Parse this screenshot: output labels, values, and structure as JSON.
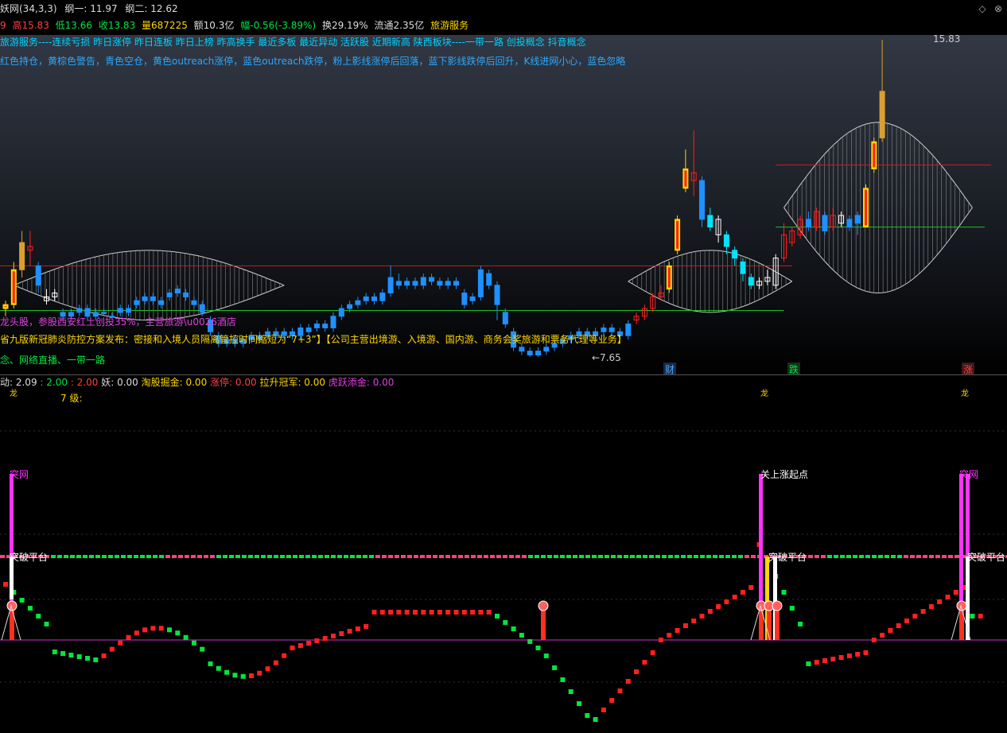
{
  "title": {
    "indicator": "妖网(34,3,3)",
    "gang1_label": "纲一: 11.97",
    "gang2_label": "纲二: 12.62"
  },
  "quote": {
    "high": "高15.83",
    "low": "低13.66",
    "close": "收13.83",
    "volume": "量687225",
    "amount": "额10.3亿",
    "change": "幅-0.56(-3.89%)",
    "turnover": "换29.19%",
    "float": "流通2.35亿",
    "sector": "旅游服务",
    "prefix": "9"
  },
  "overlay_texts": {
    "concepts": "旅游服务----连续亏损 昨日涨停 昨日连板 昨日上榜 昨高换手 最近多板 最近异动 活跃股 近期新高 陕西板块----一带一路 创投概念 抖音概念",
    "legend": "红色持仓，黄棕色警告，青色空仓，黄色outreach涨停，蓝色outreach跌停，粉上影线涨停后回落，蓝下影线跌停后回升，K线进网小心，蓝色忽略",
    "news1": "龙头股，参股西安红土创投35%，主营旅游\\u0026酒店",
    "news2": "省九版新冠肺炎防控方案发布：密接和入境人员隔离管控时间缩短为“7+3”】【公司主营出境游、入境游、国内游、商务会奖旅游和票务代理等业务】",
    "news3": "念、网络直播、一带一路",
    "max_price": "15.83",
    "min_price": "←7.65",
    "tag_cai": "财",
    "tag_die": "跌",
    "tag_zhang": "涨"
  },
  "sub_indicator": {
    "dong": "动: 2.09",
    "v2": ": 2.00",
    "v3": ": 2.00",
    "yao": "妖: 0.00",
    "taogu": "淘股掘金: 0.00",
    "zhangting": "涨停: 0.00",
    "lasheng": "拉升冠军: 0.00",
    "huyue": "虎跃添金: 0.00",
    "level": "7    级:",
    "long_mark": "龙"
  },
  "sub_labels": {
    "tuwang": "突网",
    "tupo": "突破平台",
    "qidian": "关上涨起点",
    "tupo2": "突破平台"
  },
  "colors": {
    "up_red": "#ff2020",
    "down_blue": "#1e90ff",
    "cyan": "#00e5ff",
    "yellow": "#ffd700",
    "magenta": "#ff33ff",
    "green": "#00e640",
    "pink": "#ff4080"
  },
  "chart_data": {
    "type": "candlestick",
    "price_labels": {
      "max": 15.83,
      "min": 7.65
    },
    "candles": [
      {
        "o": 8.9,
        "c": 9.0,
        "h": 9.1,
        "l": 8.7,
        "k": "yellow"
      },
      {
        "o": 9.0,
        "c": 9.9,
        "h": 10.1,
        "l": 8.9,
        "k": "yellow"
      },
      {
        "o": 9.9,
        "c": 10.6,
        "h": 10.9,
        "l": 9.7,
        "k": "brown"
      },
      {
        "o": 10.5,
        "c": 10.4,
        "h": 10.9,
        "l": 10.0,
        "k": "red"
      },
      {
        "o": 10.0,
        "c": 9.5,
        "h": 10.1,
        "l": 9.3,
        "k": "blue"
      },
      {
        "o": 9.2,
        "c": 9.1,
        "h": 9.4,
        "l": 9.0,
        "k": "white"
      },
      {
        "o": 9.2,
        "c": 9.3,
        "h": 9.4,
        "l": 9.1,
        "k": "white"
      },
      {
        "o": 8.8,
        "c": 8.7,
        "h": 8.9,
        "l": 8.6,
        "k": "blue"
      },
      {
        "o": 8.7,
        "c": 8.8,
        "h": 8.9,
        "l": 8.6,
        "k": "blue"
      },
      {
        "o": 8.9,
        "c": 8.8,
        "h": 9.0,
        "l": 8.7,
        "k": "blue"
      },
      {
        "o": 8.7,
        "c": 8.9,
        "h": 9.0,
        "l": 8.6,
        "k": "blue"
      },
      {
        "o": 8.8,
        "c": 8.7,
        "h": 8.9,
        "l": 8.6,
        "k": "blue"
      },
      {
        "o": 8.8,
        "c": 8.8,
        "h": 8.9,
        "l": 8.7,
        "k": "blue"
      },
      {
        "o": 8.7,
        "c": 8.7,
        "h": 8.8,
        "l": 8.6,
        "k": "blue"
      },
      {
        "o": 8.8,
        "c": 8.9,
        "h": 9.0,
        "l": 8.7,
        "k": "blue"
      },
      {
        "o": 8.9,
        "c": 8.8,
        "h": 9.0,
        "l": 8.7,
        "k": "blue"
      },
      {
        "o": 9.0,
        "c": 9.1,
        "h": 9.2,
        "l": 8.9,
        "k": "blue"
      },
      {
        "o": 9.1,
        "c": 9.2,
        "h": 9.3,
        "l": 9.0,
        "k": "blue"
      },
      {
        "o": 9.2,
        "c": 9.1,
        "h": 9.3,
        "l": 9.0,
        "k": "blue"
      },
      {
        "o": 9.1,
        "c": 9.0,
        "h": 9.2,
        "l": 8.9,
        "k": "blue"
      },
      {
        "o": 9.2,
        "c": 9.3,
        "h": 9.4,
        "l": 9.1,
        "k": "blue"
      },
      {
        "o": 9.3,
        "c": 9.4,
        "h": 9.5,
        "l": 9.2,
        "k": "blue"
      },
      {
        "o": 9.3,
        "c": 9.2,
        "h": 9.4,
        "l": 9.1,
        "k": "blue"
      },
      {
        "o": 9.1,
        "c": 9.0,
        "h": 9.2,
        "l": 8.9,
        "k": "blue"
      },
      {
        "o": 9.0,
        "c": 8.8,
        "h": 9.1,
        "l": 8.7,
        "k": "blue"
      },
      {
        "o": 8.6,
        "c": 8.3,
        "h": 8.7,
        "l": 8.2,
        "k": "blue"
      },
      {
        "o": 8.2,
        "c": 8.0,
        "h": 8.3,
        "l": 7.9,
        "k": "blue"
      },
      {
        "o": 8.1,
        "c": 8.0,
        "h": 8.2,
        "l": 7.9,
        "k": "blue"
      },
      {
        "o": 8.0,
        "c": 8.1,
        "h": 8.2,
        "l": 7.9,
        "k": "blue"
      },
      {
        "o": 8.1,
        "c": 8.0,
        "h": 8.2,
        "l": 7.9,
        "k": "blue"
      },
      {
        "o": 8.1,
        "c": 8.2,
        "h": 8.3,
        "l": 8.0,
        "k": "blue"
      },
      {
        "o": 8.2,
        "c": 8.1,
        "h": 8.3,
        "l": 8.0,
        "k": "blue"
      },
      {
        "o": 8.2,
        "c": 8.3,
        "h": 8.4,
        "l": 8.1,
        "k": "blue"
      },
      {
        "o": 8.3,
        "c": 8.2,
        "h": 8.4,
        "l": 8.1,
        "k": "blue"
      },
      {
        "o": 8.2,
        "c": 8.3,
        "h": 8.4,
        "l": 8.1,
        "k": "blue"
      },
      {
        "o": 8.3,
        "c": 8.2,
        "h": 8.4,
        "l": 8.1,
        "k": "blue"
      },
      {
        "o": 8.2,
        "c": 8.4,
        "h": 8.5,
        "l": 8.1,
        "k": "blue"
      },
      {
        "o": 8.4,
        "c": 8.3,
        "h": 8.5,
        "l": 8.2,
        "k": "blue"
      },
      {
        "o": 8.4,
        "c": 8.5,
        "h": 8.6,
        "l": 8.3,
        "k": "blue"
      },
      {
        "o": 8.5,
        "c": 8.4,
        "h": 8.6,
        "l": 8.3,
        "k": "blue"
      },
      {
        "o": 8.4,
        "c": 8.7,
        "h": 8.8,
        "l": 8.3,
        "k": "blue"
      },
      {
        "o": 8.7,
        "c": 8.9,
        "h": 9.0,
        "l": 8.6,
        "k": "blue"
      },
      {
        "o": 8.9,
        "c": 9.0,
        "h": 9.1,
        "l": 8.8,
        "k": "blue"
      },
      {
        "o": 9.0,
        "c": 9.1,
        "h": 9.2,
        "l": 8.9,
        "k": "blue"
      },
      {
        "o": 9.1,
        "c": 9.2,
        "h": 9.3,
        "l": 9.0,
        "k": "blue"
      },
      {
        "o": 9.2,
        "c": 9.1,
        "h": 9.3,
        "l": 9.0,
        "k": "blue"
      },
      {
        "o": 9.1,
        "c": 9.3,
        "h": 9.4,
        "l": 9.0,
        "k": "blue"
      },
      {
        "o": 9.3,
        "c": 9.7,
        "h": 10.0,
        "l": 9.2,
        "k": "blue"
      },
      {
        "o": 9.6,
        "c": 9.5,
        "h": 9.8,
        "l": 9.4,
        "k": "blue"
      },
      {
        "o": 9.5,
        "c": 9.6,
        "h": 9.7,
        "l": 9.4,
        "k": "blue"
      },
      {
        "o": 9.6,
        "c": 9.5,
        "h": 9.7,
        "l": 9.4,
        "k": "blue"
      },
      {
        "o": 9.5,
        "c": 9.7,
        "h": 9.8,
        "l": 9.4,
        "k": "blue"
      },
      {
        "o": 9.7,
        "c": 9.6,
        "h": 9.8,
        "l": 9.5,
        "k": "blue"
      },
      {
        "o": 9.6,
        "c": 9.5,
        "h": 9.7,
        "l": 9.4,
        "k": "blue"
      },
      {
        "o": 9.5,
        "c": 9.6,
        "h": 9.7,
        "l": 9.4,
        "k": "blue"
      },
      {
        "o": 9.6,
        "c": 9.5,
        "h": 9.7,
        "l": 9.4,
        "k": "blue"
      },
      {
        "o": 9.3,
        "c": 9.0,
        "h": 9.4,
        "l": 8.9,
        "k": "blue"
      },
      {
        "o": 9.1,
        "c": 9.2,
        "h": 9.3,
        "l": 9.0,
        "k": "blue"
      },
      {
        "o": 9.2,
        "c": 9.9,
        "h": 10.0,
        "l": 9.1,
        "k": "blue"
      },
      {
        "o": 9.8,
        "c": 9.5,
        "h": 9.9,
        "l": 9.4,
        "k": "blue"
      },
      {
        "o": 9.5,
        "c": 9.0,
        "h": 9.6,
        "l": 8.6,
        "k": "blue"
      },
      {
        "o": 8.8,
        "c": 8.5,
        "h": 8.9,
        "l": 8.4,
        "k": "blue"
      },
      {
        "o": 8.3,
        "c": 7.9,
        "h": 8.4,
        "l": 7.8,
        "k": "blue"
      },
      {
        "o": 7.9,
        "c": 7.8,
        "h": 8.0,
        "l": 7.7,
        "k": "blue"
      },
      {
        "o": 7.8,
        "c": 7.7,
        "h": 7.9,
        "l": 7.65,
        "k": "blue"
      },
      {
        "o": 7.7,
        "c": 7.8,
        "h": 7.9,
        "l": 7.65,
        "k": "blue"
      },
      {
        "o": 7.8,
        "c": 7.9,
        "h": 8.0,
        "l": 7.7,
        "k": "blue"
      },
      {
        "o": 7.9,
        "c": 8.0,
        "h": 8.1,
        "l": 7.8,
        "k": "blue"
      },
      {
        "o": 8.0,
        "c": 8.1,
        "h": 8.2,
        "l": 7.9,
        "k": "blue"
      },
      {
        "o": 8.1,
        "c": 8.2,
        "h": 8.3,
        "l": 8.0,
        "k": "blue"
      },
      {
        "o": 8.2,
        "c": 8.3,
        "h": 8.4,
        "l": 8.1,
        "k": "blue"
      },
      {
        "o": 8.3,
        "c": 8.2,
        "h": 8.4,
        "l": 8.1,
        "k": "blue"
      },
      {
        "o": 8.2,
        "c": 8.3,
        "h": 8.4,
        "l": 8.1,
        "k": "blue"
      },
      {
        "o": 8.3,
        "c": 8.4,
        "h": 8.5,
        "l": 8.2,
        "k": "blue"
      },
      {
        "o": 8.4,
        "c": 8.3,
        "h": 8.5,
        "l": 8.2,
        "k": "blue"
      },
      {
        "o": 8.3,
        "c": 8.2,
        "h": 8.4,
        "l": 8.1,
        "k": "blue"
      },
      {
        "o": 8.2,
        "c": 8.5,
        "h": 8.6,
        "l": 8.1,
        "k": "blue"
      },
      {
        "o": 8.6,
        "c": 8.7,
        "h": 8.8,
        "l": 8.5,
        "k": "red"
      },
      {
        "o": 8.7,
        "c": 8.9,
        "h": 9.0,
        "l": 8.6,
        "k": "red"
      },
      {
        "o": 8.9,
        "c": 9.2,
        "h": 9.3,
        "l": 8.8,
        "k": "red"
      },
      {
        "o": 9.2,
        "c": 9.3,
        "h": 9.5,
        "l": 9.1,
        "k": "red"
      },
      {
        "o": 9.4,
        "c": 10.0,
        "h": 10.1,
        "l": 9.3,
        "k": "yellow"
      },
      {
        "o": 10.4,
        "c": 11.2,
        "h": 11.3,
        "l": 10.3,
        "k": "yellow"
      },
      {
        "o": 12.0,
        "c": 12.5,
        "h": 13.0,
        "l": 11.9,
        "k": "yellow"
      },
      {
        "o": 12.4,
        "c": 12.2,
        "h": 13.5,
        "l": 11.8,
        "k": "red"
      },
      {
        "o": 12.2,
        "c": 11.2,
        "h": 12.3,
        "l": 11.0,
        "k": "blue"
      },
      {
        "o": 11.3,
        "c": 11.0,
        "h": 11.5,
        "l": 10.9,
        "k": "cyan"
      },
      {
        "o": 11.2,
        "c": 10.8,
        "h": 11.3,
        "l": 10.6,
        "k": "white"
      },
      {
        "o": 10.8,
        "c": 10.5,
        "h": 10.9,
        "l": 10.3,
        "k": "cyan"
      },
      {
        "o": 10.4,
        "c": 10.2,
        "h": 10.5,
        "l": 10.0,
        "k": "cyan"
      },
      {
        "o": 10.1,
        "c": 9.8,
        "h": 10.2,
        "l": 9.6,
        "k": "cyan"
      },
      {
        "o": 9.7,
        "c": 9.5,
        "h": 9.8,
        "l": 9.4,
        "k": "cyan"
      },
      {
        "o": 9.5,
        "c": 9.6,
        "h": 9.7,
        "l": 9.4,
        "k": "white"
      },
      {
        "o": 9.6,
        "c": 9.7,
        "h": 9.9,
        "l": 9.5,
        "k": "white"
      },
      {
        "o": 9.5,
        "c": 10.2,
        "h": 10.3,
        "l": 9.4,
        "k": "white"
      },
      {
        "o": 10.2,
        "c": 10.8,
        "h": 11.1,
        "l": 10.1,
        "k": "red"
      },
      {
        "o": 10.6,
        "c": 10.9,
        "h": 11.0,
        "l": 10.5,
        "k": "red"
      },
      {
        "o": 10.8,
        "c": 11.2,
        "h": 11.3,
        "l": 10.7,
        "k": "red"
      },
      {
        "o": 11.2,
        "c": 11.0,
        "h": 11.4,
        "l": 10.9,
        "k": "blue"
      },
      {
        "o": 11.0,
        "c": 11.4,
        "h": 11.5,
        "l": 10.9,
        "k": "red"
      },
      {
        "o": 11.3,
        "c": 10.9,
        "h": 11.4,
        "l": 10.8,
        "k": "blue"
      },
      {
        "o": 11.0,
        "c": 11.3,
        "h": 11.5,
        "l": 10.9,
        "k": "red"
      },
      {
        "o": 11.3,
        "c": 11.1,
        "h": 11.4,
        "l": 11.0,
        "k": "white"
      },
      {
        "o": 11.2,
        "c": 11.0,
        "h": 11.3,
        "l": 10.9,
        "k": "blue"
      },
      {
        "o": 11.1,
        "c": 11.3,
        "h": 11.4,
        "l": 10.8,
        "k": "blue"
      },
      {
        "o": 11.0,
        "c": 12.0,
        "h": 12.1,
        "l": 11.0,
        "k": "yellow"
      },
      {
        "o": 12.5,
        "c": 13.2,
        "h": 13.3,
        "l": 12.4,
        "k": "yellow"
      },
      {
        "o": 13.3,
        "c": 14.5,
        "h": 15.83,
        "l": 13.2,
        "k": "brown"
      }
    ]
  }
}
